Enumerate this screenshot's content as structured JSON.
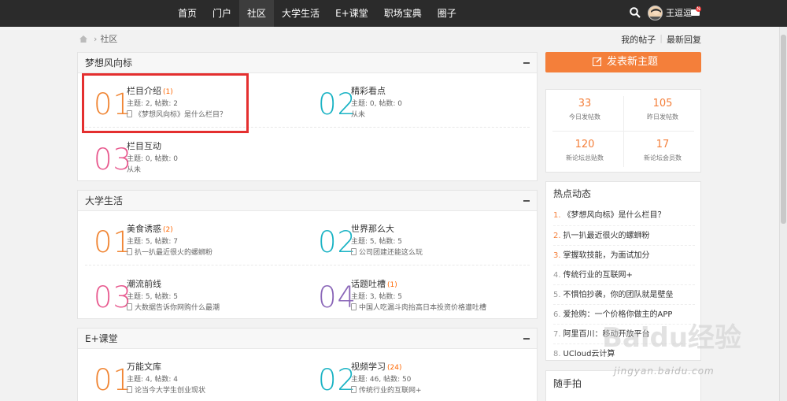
{
  "nav": {
    "items": [
      "首页",
      "门户",
      "社区",
      "大学生活",
      "E+课堂",
      "职场宝典",
      "圈子"
    ],
    "active_index": 2,
    "username": "王逗逗",
    "mail_badge": "N"
  },
  "breadcrumb": {
    "current": "社区"
  },
  "top_links": {
    "my_posts": "我的帖子",
    "sep": "|",
    "latest": "最新回复"
  },
  "sections": [
    {
      "title": "梦想风向标",
      "forums": [
        {
          "num": "01",
          "name": "栏目介绍",
          "count": "(1)",
          "stats": "主题: 2, 帖数: 2",
          "last": "《梦想风向标》是什么栏目？",
          "has_icon": true
        },
        {
          "num": "02",
          "name": "精彩看点",
          "count": "",
          "stats": "主题: 0, 帖数: 0",
          "last": "从未",
          "has_icon": false
        },
        {
          "num": "03",
          "name": "栏目互动",
          "count": "",
          "stats": "主题: 0, 帖数: 0",
          "last": "从未",
          "has_icon": false
        }
      ]
    },
    {
      "title": "大学生活",
      "forums": [
        {
          "num": "01",
          "name": "美食诱惑",
          "count": "(2)",
          "stats": "主题: 5, 帖数: 7",
          "last": "扒一扒最近很火的螺蛳粉",
          "has_icon": true
        },
        {
          "num": "02",
          "name": "世界那么大",
          "count": "",
          "stats": "主题: 5, 帖数: 5",
          "last": "公司团建还能这么玩",
          "has_icon": true
        },
        {
          "num": "03",
          "name": "潮流前线",
          "count": "",
          "stats": "主题: 5, 帖数: 5",
          "last": "大数据告诉你网购什么最潮",
          "has_icon": true
        },
        {
          "num": "04",
          "name": "话题吐槽",
          "count": "(1)",
          "stats": "主题: 3, 帖数: 5",
          "last": "中国人吃漏斗肉抬高日本投资价格遭吐槽",
          "has_icon": true
        }
      ]
    },
    {
      "title": "E+课堂",
      "forums": [
        {
          "num": "01",
          "name": "万能文库",
          "count": "",
          "stats": "主题: 4, 帖数: 4",
          "last": "论当今大学生创业现状",
          "has_icon": true
        },
        {
          "num": "02",
          "name": "视频学习",
          "count": "(24)",
          "stats": "主题: 46, 帖数: 50",
          "last": "传统行业的互联网+",
          "has_icon": true
        }
      ]
    }
  ],
  "sidebar": {
    "post_button": "发表新主题",
    "stats": [
      {
        "value": "33",
        "label": "今日发帖数"
      },
      {
        "value": "105",
        "label": "昨日发帖数"
      },
      {
        "value": "120",
        "label": "新论坛总贴数"
      },
      {
        "value": "17",
        "label": "新论坛会员数"
      }
    ],
    "hot_title": "热点动态",
    "hot_items": [
      {
        "rank": "1.",
        "text": "《梦想风向标》是什么栏目？"
      },
      {
        "rank": "2.",
        "text": "扒一扒最近很火的螺蛳粉"
      },
      {
        "rank": "3.",
        "text": "掌握软技能，为面试加分"
      },
      {
        "rank": "4.",
        "text": "传统行业的互联网+"
      },
      {
        "rank": "5.",
        "text": "不惧怕抄袭，你的团队就是壁垒"
      },
      {
        "rank": "6.",
        "text": "爱抢购：一个价格你做主的APP"
      },
      {
        "rank": "7.",
        "text": "阿里百川：移动开放平台"
      },
      {
        "rank": "8.",
        "text": "UCloud云计算"
      }
    ],
    "snap_title": "随手拍"
  },
  "colors": {
    "accent": "#f47f3a",
    "highlight": "#e42f2f",
    "num_orange": "#f08533",
    "num_cyan": "#1ab3c4",
    "num_pink": "#e85a8f",
    "num_purple": "#8a66b8"
  },
  "watermark": {
    "logo": "Baidu经验",
    "url": "jingyan.baidu.com"
  }
}
